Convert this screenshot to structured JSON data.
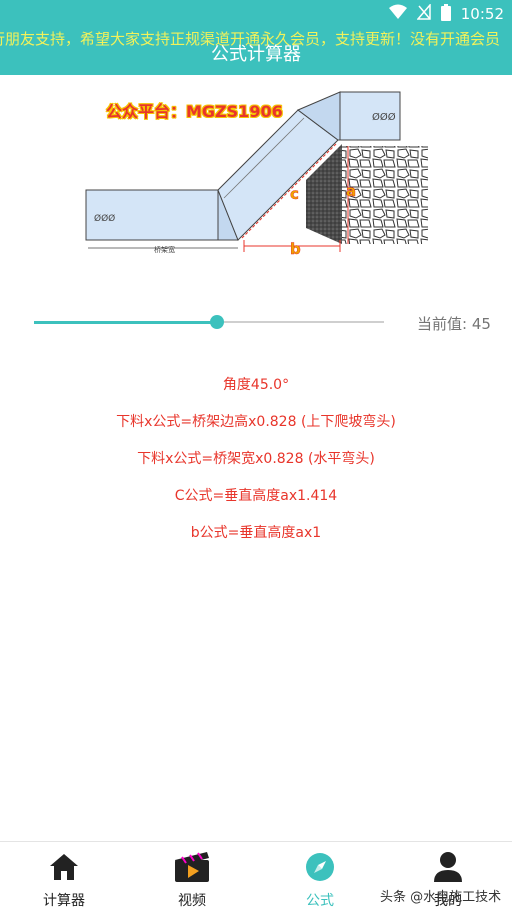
{
  "status_bar": {
    "time": "10:52"
  },
  "header": {
    "marquee": "行朋友支持，希望大家支持正规渠道开通永久会员，支持更新！没有开通会员",
    "title": "公式计算器"
  },
  "diagram": {
    "watermark": "公众平台：MGZS1906",
    "label_a": "a",
    "label_b": "b",
    "label_c": "c",
    "dimension_label": "桥架宽",
    "box_left_text": "ØØØ",
    "box_right_text": "ØØØ"
  },
  "slider": {
    "value": 45,
    "min": 0,
    "max": 90,
    "current_label": "当前值: 45"
  },
  "formulas": [
    "角度45.0°",
    "下料x公式=桥架边高x0.828 (上下爬坡弯头)",
    "下料x公式=桥架宽x0.828 (水平弯头)",
    "C公式=垂直高度ax1.414",
    "b公式=垂直高度ax1"
  ],
  "nav": {
    "items": [
      {
        "label": "计算器",
        "icon": "home-icon"
      },
      {
        "label": "视频",
        "icon": "video-icon"
      },
      {
        "label": "公式",
        "icon": "compass-icon"
      },
      {
        "label": "我的",
        "icon": "user-icon"
      }
    ],
    "active_index": 2
  },
  "watermark_toutiao": "头条 @水电施工技术",
  "colors": {
    "accent": "#3cc1bd",
    "formula_text": "#e8352b",
    "marquee_text": "#f2f25a"
  }
}
